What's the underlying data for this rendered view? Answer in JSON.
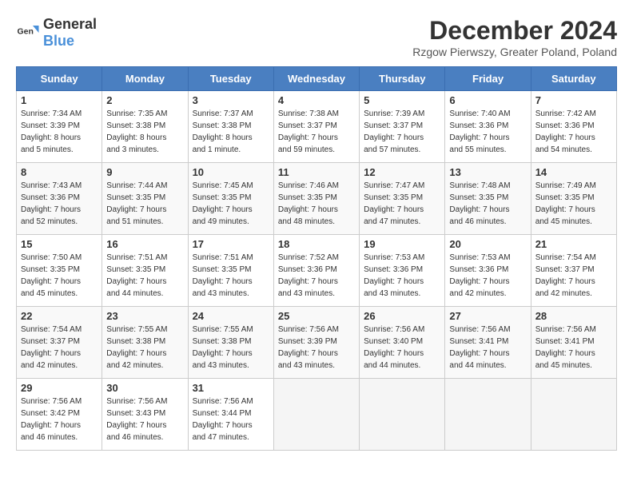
{
  "logo": {
    "general": "General",
    "blue": "Blue"
  },
  "title": "December 2024",
  "location": "Rzgow Pierwszy, Greater Poland, Poland",
  "days_of_week": [
    "Sunday",
    "Monday",
    "Tuesday",
    "Wednesday",
    "Thursday",
    "Friday",
    "Saturday"
  ],
  "weeks": [
    [
      {
        "day": 1,
        "info": "Sunrise: 7:34 AM\nSunset: 3:39 PM\nDaylight: 8 hours\nand 5 minutes."
      },
      {
        "day": 2,
        "info": "Sunrise: 7:35 AM\nSunset: 3:38 PM\nDaylight: 8 hours\nand 3 minutes."
      },
      {
        "day": 3,
        "info": "Sunrise: 7:37 AM\nSunset: 3:38 PM\nDaylight: 8 hours\nand 1 minute."
      },
      {
        "day": 4,
        "info": "Sunrise: 7:38 AM\nSunset: 3:37 PM\nDaylight: 7 hours\nand 59 minutes."
      },
      {
        "day": 5,
        "info": "Sunrise: 7:39 AM\nSunset: 3:37 PM\nDaylight: 7 hours\nand 57 minutes."
      },
      {
        "day": 6,
        "info": "Sunrise: 7:40 AM\nSunset: 3:36 PM\nDaylight: 7 hours\nand 55 minutes."
      },
      {
        "day": 7,
        "info": "Sunrise: 7:42 AM\nSunset: 3:36 PM\nDaylight: 7 hours\nand 54 minutes."
      }
    ],
    [
      {
        "day": 8,
        "info": "Sunrise: 7:43 AM\nSunset: 3:36 PM\nDaylight: 7 hours\nand 52 minutes."
      },
      {
        "day": 9,
        "info": "Sunrise: 7:44 AM\nSunset: 3:35 PM\nDaylight: 7 hours\nand 51 minutes."
      },
      {
        "day": 10,
        "info": "Sunrise: 7:45 AM\nSunset: 3:35 PM\nDaylight: 7 hours\nand 49 minutes."
      },
      {
        "day": 11,
        "info": "Sunrise: 7:46 AM\nSunset: 3:35 PM\nDaylight: 7 hours\nand 48 minutes."
      },
      {
        "day": 12,
        "info": "Sunrise: 7:47 AM\nSunset: 3:35 PM\nDaylight: 7 hours\nand 47 minutes."
      },
      {
        "day": 13,
        "info": "Sunrise: 7:48 AM\nSunset: 3:35 PM\nDaylight: 7 hours\nand 46 minutes."
      },
      {
        "day": 14,
        "info": "Sunrise: 7:49 AM\nSunset: 3:35 PM\nDaylight: 7 hours\nand 45 minutes."
      }
    ],
    [
      {
        "day": 15,
        "info": "Sunrise: 7:50 AM\nSunset: 3:35 PM\nDaylight: 7 hours\nand 45 minutes."
      },
      {
        "day": 16,
        "info": "Sunrise: 7:51 AM\nSunset: 3:35 PM\nDaylight: 7 hours\nand 44 minutes."
      },
      {
        "day": 17,
        "info": "Sunrise: 7:51 AM\nSunset: 3:35 PM\nDaylight: 7 hours\nand 43 minutes."
      },
      {
        "day": 18,
        "info": "Sunrise: 7:52 AM\nSunset: 3:36 PM\nDaylight: 7 hours\nand 43 minutes."
      },
      {
        "day": 19,
        "info": "Sunrise: 7:53 AM\nSunset: 3:36 PM\nDaylight: 7 hours\nand 43 minutes."
      },
      {
        "day": 20,
        "info": "Sunrise: 7:53 AM\nSunset: 3:36 PM\nDaylight: 7 hours\nand 42 minutes."
      },
      {
        "day": 21,
        "info": "Sunrise: 7:54 AM\nSunset: 3:37 PM\nDaylight: 7 hours\nand 42 minutes."
      }
    ],
    [
      {
        "day": 22,
        "info": "Sunrise: 7:54 AM\nSunset: 3:37 PM\nDaylight: 7 hours\nand 42 minutes."
      },
      {
        "day": 23,
        "info": "Sunrise: 7:55 AM\nSunset: 3:38 PM\nDaylight: 7 hours\nand 42 minutes."
      },
      {
        "day": 24,
        "info": "Sunrise: 7:55 AM\nSunset: 3:38 PM\nDaylight: 7 hours\nand 43 minutes."
      },
      {
        "day": 25,
        "info": "Sunrise: 7:56 AM\nSunset: 3:39 PM\nDaylight: 7 hours\nand 43 minutes."
      },
      {
        "day": 26,
        "info": "Sunrise: 7:56 AM\nSunset: 3:40 PM\nDaylight: 7 hours\nand 44 minutes."
      },
      {
        "day": 27,
        "info": "Sunrise: 7:56 AM\nSunset: 3:41 PM\nDaylight: 7 hours\nand 44 minutes."
      },
      {
        "day": 28,
        "info": "Sunrise: 7:56 AM\nSunset: 3:41 PM\nDaylight: 7 hours\nand 45 minutes."
      }
    ],
    [
      {
        "day": 29,
        "info": "Sunrise: 7:56 AM\nSunset: 3:42 PM\nDaylight: 7 hours\nand 46 minutes."
      },
      {
        "day": 30,
        "info": "Sunrise: 7:56 AM\nSunset: 3:43 PM\nDaylight: 7 hours\nand 46 minutes."
      },
      {
        "day": 31,
        "info": "Sunrise: 7:56 AM\nSunset: 3:44 PM\nDaylight: 7 hours\nand 47 minutes."
      },
      null,
      null,
      null,
      null
    ]
  ]
}
